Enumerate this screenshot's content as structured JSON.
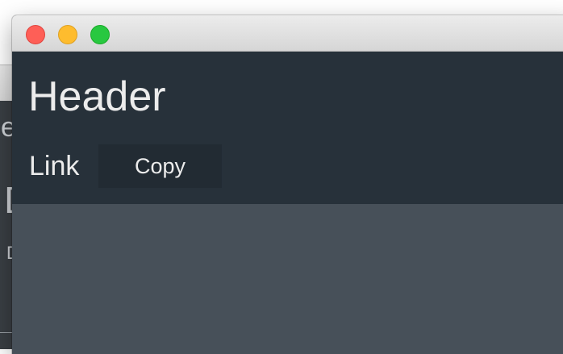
{
  "background_window": {
    "text_top": "e",
    "text_mid": "[",
    "text_low": "D"
  },
  "window": {
    "header": {
      "title": "Header",
      "link_label": "Link",
      "copy_label": "Copy"
    }
  },
  "colors": {
    "header_bg": "#27313a",
    "content_bg": "#475059",
    "button_bg": "#222b33",
    "text": "#ececec",
    "close": "#fe5f57",
    "minimize": "#febc2e",
    "maximize": "#28c840"
  }
}
